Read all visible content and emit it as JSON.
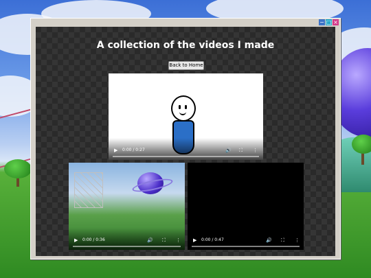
{
  "window": {
    "controls": {
      "minimize": "−",
      "maximize": "□",
      "close": "×"
    }
  },
  "page": {
    "title": "A collection of the videos I made",
    "back_button": "Back to Home"
  },
  "videos": [
    {
      "time": "0:00 / 0:27",
      "play": "▶",
      "volume": "🔊",
      "fullscreen": "⛶",
      "menu": "⋮"
    },
    {
      "time": "0:00 / 0:36",
      "play": "▶",
      "volume": "🔊",
      "fullscreen": "⛶",
      "menu": "⋮"
    },
    {
      "time": "0:00 / 0:47",
      "play": "▶",
      "volume": "🔊",
      "fullscreen": "⛶",
      "menu": "⋮"
    }
  ],
  "colors": {
    "accent": "#3d74c9",
    "close": "#d43a8a",
    "content_bg": "#2a2a2a"
  }
}
